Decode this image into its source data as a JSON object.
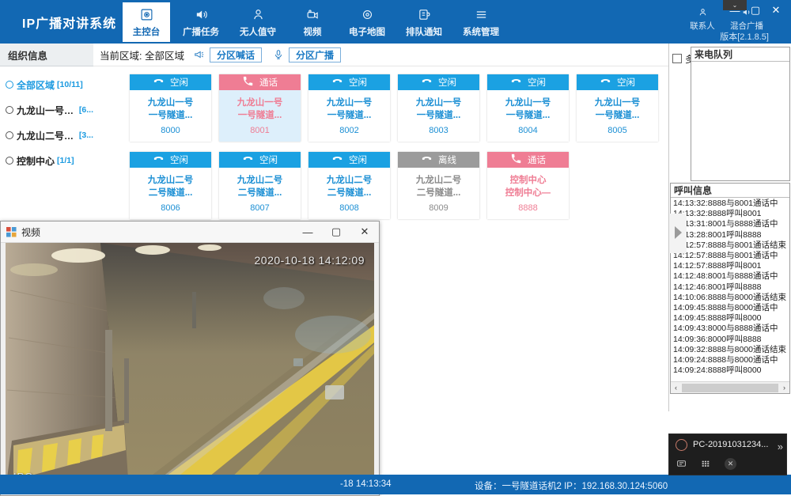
{
  "app": {
    "brand": "IP广播对讲系统",
    "version": "版本[2.1.8.5]"
  },
  "nav": {
    "tabs": [
      {
        "label": "主控台",
        "icon": "console-icon",
        "active": true
      },
      {
        "label": "广播任务",
        "icon": "speaker-icon",
        "active": false
      },
      {
        "label": "无人值守",
        "icon": "person-icon",
        "active": false
      },
      {
        "label": "视频",
        "icon": "video-camera-icon",
        "active": false
      },
      {
        "label": "电子地图",
        "icon": "map-pin-icon",
        "active": false
      },
      {
        "label": "排队通知",
        "icon": "queue-icon",
        "active": false
      },
      {
        "label": "系统管理",
        "icon": "menu-icon",
        "active": false
      }
    ],
    "right_items": [
      {
        "label": "联系人",
        "icon": "contacts-icon"
      },
      {
        "label": "混合广播",
        "icon": "broadcast-icon"
      }
    ],
    "window_controls": {
      "minimize": "—",
      "maximize": "▢",
      "close": "✕",
      "chevron": "⌄"
    }
  },
  "sidebar": {
    "header": "组织信息",
    "items": [
      {
        "name": "全部区域",
        "count": "[10/11]",
        "selected": true
      },
      {
        "name": "九龙山一号隧道",
        "count": "[6...",
        "selected": false
      },
      {
        "name": "九龙山二号隧道",
        "count": "[3...",
        "selected": false
      },
      {
        "name": "控制中心",
        "count": "[1/1]",
        "selected": false
      }
    ]
  },
  "toolbar": {
    "current_zone_label": "当前区域:",
    "current_zone_value": "全部区域",
    "zone_shout_button": "分区喊话",
    "zone_broadcast_button": "分区广播",
    "shout_icon": "megaphone-icon",
    "broadcast_icon": "microphone-icon"
  },
  "devices": [
    {
      "status": "空闲",
      "state": "idle",
      "line1": "九龙山一号",
      "line2": "一号隧道...",
      "ext": "8000",
      "icon": "handset-down-icon"
    },
    {
      "status": "通话",
      "state": "talk",
      "line1": "九龙山一号",
      "line2": "一号隧道...",
      "ext": "8001",
      "icon": "handset-active-icon"
    },
    {
      "status": "空闲",
      "state": "idle",
      "line1": "九龙山一号",
      "line2": "一号隧道...",
      "ext": "8002",
      "icon": "handset-down-icon"
    },
    {
      "status": "空闲",
      "state": "idle",
      "line1": "九龙山一号",
      "line2": "一号隧道...",
      "ext": "8003",
      "icon": "handset-down-icon"
    },
    {
      "status": "空闲",
      "state": "idle",
      "line1": "九龙山一号",
      "line2": "一号隧道...",
      "ext": "8004",
      "icon": "handset-down-icon"
    },
    {
      "status": "空闲",
      "state": "idle",
      "line1": "九龙山一号",
      "line2": "一号隧道...",
      "ext": "8005",
      "icon": "handset-down-icon"
    },
    {
      "status": "空闲",
      "state": "idle",
      "line1": "九龙山二号",
      "line2": "二号隧道...",
      "ext": "8006",
      "icon": "handset-down-icon"
    },
    {
      "status": "空闲",
      "state": "idle",
      "line1": "九龙山二号",
      "line2": "二号隧道...",
      "ext": "8007",
      "icon": "handset-down-icon"
    },
    {
      "status": "空闲",
      "state": "idle",
      "line1": "九龙山二号",
      "line2": "二号隧道...",
      "ext": "8008",
      "icon": "handset-down-icon"
    },
    {
      "status": "离线",
      "state": "off",
      "line1": "九龙山二号",
      "line2": "二号隧道...",
      "ext": "8009",
      "icon": "handset-down-icon"
    },
    {
      "status": "通话",
      "state": "talk-white",
      "line1": "控制中心",
      "line2": "控制中心—",
      "ext": "8888",
      "icon": "handset-active-icon"
    }
  ],
  "right_panel": {
    "multiselect_label": "多选",
    "incoming_queue_header": "来电队列",
    "call_info_header": "呼叫信息",
    "call_log": [
      "14:13:32:8888与8001通话中",
      "14:13:32:8888呼叫8001",
      "14:13:31:8001与8888通话中",
      "14:13:28:8001呼叫8888",
      "14:12:57:8888与8001通话结束",
      "14:12:57:8888与8001通话中",
      "14:12:57:8888呼叫8001",
      "14:12:48:8001与8888通话中",
      "14:12:46:8001呼叫8888",
      "14:10:06:8888与8000通话结束",
      "14:09:45:8888与8000通话中",
      "14:09:45:8888呼叫8000",
      "14:09:43:8000与8888通话中",
      "14:09:36:8000呼叫8888",
      "14:09:32:8888与8000通话结束",
      "14:09:24:8888与8000通话中",
      "14:09:24:8888呼叫8000"
    ],
    "scroll_left": "‹",
    "scroll_right": "›",
    "collapse_icon": "triangle-right-icon"
  },
  "video_window": {
    "title": "视频",
    "icon": "window-app-icon",
    "minimize": "—",
    "maximize": "▢",
    "close": "✕",
    "timestamp": "2020-10-18 14:12:09",
    "camera_label": "IPC"
  },
  "status_bar": {
    "time": "-18 14:13:34",
    "device_label": "设备：一号隧道话机2  IP：192.168.30.124:5060"
  },
  "popup": {
    "name": "PC-20191031234...",
    "chat_icon": "chat-icon",
    "grid_icon": "keypad-icon",
    "close_icon": "close-icon",
    "play_icon": "play-arrow-icon",
    "avatar_icon": "user-avatar-icon"
  },
  "colors": {
    "brand_blue": "#1268b3",
    "idle_blue": "#1ba1e2",
    "talk_pink": "#ef7d94",
    "offline_gray": "#9b9b9b",
    "accent_link": "#1b9ae0"
  }
}
